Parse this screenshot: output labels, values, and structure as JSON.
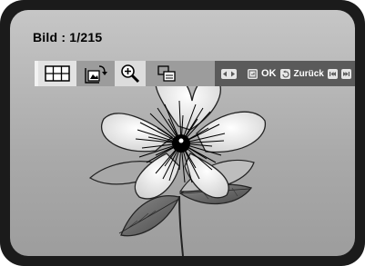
{
  "screen": {
    "title": "Bild : 1/215"
  },
  "toolbar": {
    "items": [
      {
        "name": "thumbnail-grid",
        "icon": "grid-icon",
        "active": true
      },
      {
        "name": "rotate",
        "icon": "rotate-image-icon",
        "active": false
      },
      {
        "name": "zoom",
        "icon": "zoom-in-icon",
        "active": false
      },
      {
        "name": "copy",
        "icon": "copy-icon",
        "active": false
      }
    ]
  },
  "hint_bar": {
    "ok_label": "OK",
    "back_label": "Zurück"
  },
  "colors": {
    "bezel": "#1b1b1b",
    "hint_bar": "#5a5a5a",
    "toolbar": "#9c9c9c",
    "active_button": "#e3e3e3"
  }
}
